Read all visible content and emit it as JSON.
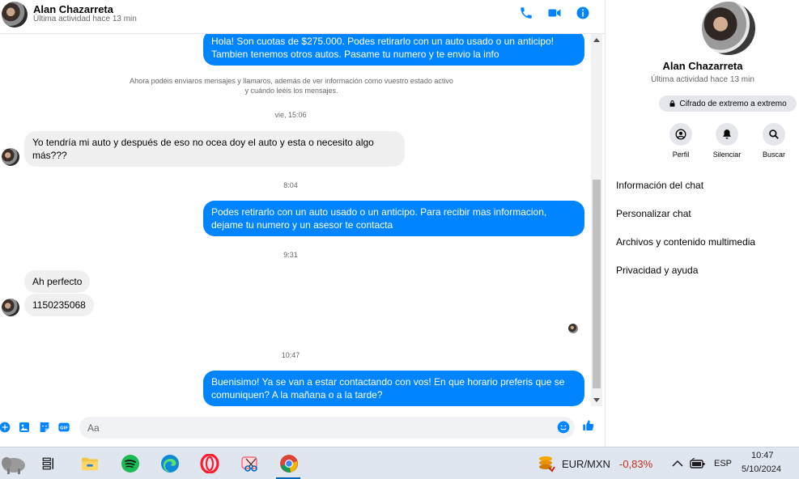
{
  "header": {
    "name": "Alan Chazarreta",
    "status": "Última actividad hace 13 min"
  },
  "messages": {
    "m1": "Hola! Son cuotas de $275.000. Podes retirarlo con un auto usado o un anticipo! Tambien tenemos otros autos. Pasame tu numero y te envio la info",
    "system": "Ahora podéis enviaros mensajes y llamaros, además de ver información como vuestro estado activo y cuándo leéis los mensajes.",
    "ts1": "vie, 15:06",
    "m2": "Yo tendría mi auto y después de eso no ocea doy el auto y esta o necesito algo más???",
    "ts2": "8:04",
    "m3": "Podes retirarlo con un auto usado o un anticipo. Para recibir mas informacion, dejame tu numero y un asesor te contacta",
    "ts3": "9:31",
    "m4": "Ah perfecto",
    "m5": "1150235068",
    "ts4": "10:47",
    "m6": "Buenisimo! Ya se van a estar contactando con vos! En que horario preferis que se comuniquen? A la mañana o a la tarde?"
  },
  "composer": {
    "placeholder": "Aa"
  },
  "side": {
    "name": "Alan Chazarreta",
    "status": "Última actividad hace 13 min",
    "e2e": "Cifrado de extremo a extremo",
    "actions": [
      "Perfil",
      "Silenciar",
      "Buscar"
    ],
    "menu": [
      "Información del chat",
      "Personalizar chat",
      "Archivos y contenido multimedia",
      "Privacidad y ayuda"
    ]
  },
  "taskbar": {
    "currency_pair": "EUR/MXN",
    "currency_change": "-0,83%",
    "lang": "ESP",
    "time": "10:47",
    "date": "5/10/2024"
  },
  "colors": {
    "accent": "#0084ff",
    "negative": "#c42b1c"
  }
}
